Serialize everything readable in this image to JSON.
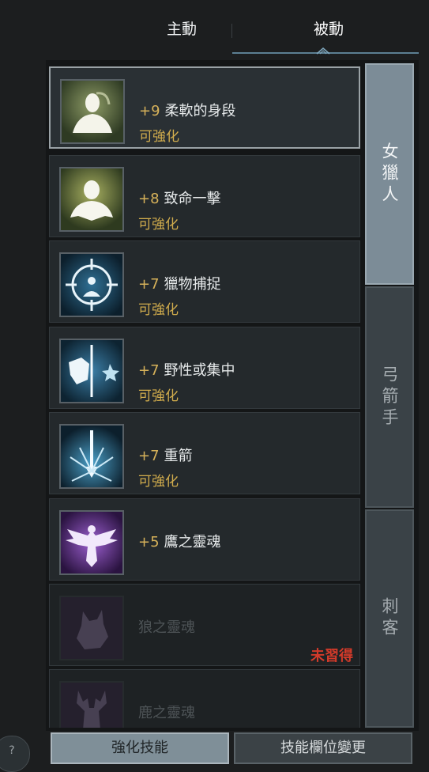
{
  "tabs": {
    "active_label": "主動",
    "passive_label": "被動",
    "selected": "passive"
  },
  "skills": [
    {
      "level": "+9",
      "name": "柔軟的身段",
      "status": "可強化",
      "icon": "woman-silhouette-icon",
      "selected": true,
      "locked": false
    },
    {
      "level": "+8",
      "name": "致命一擊",
      "status": "可強化",
      "icon": "bust-silhouette-icon",
      "selected": false,
      "locked": false
    },
    {
      "level": "+7",
      "name": "獵物捕捉",
      "status": "可強化",
      "icon": "crosshair-icon",
      "selected": false,
      "locked": false
    },
    {
      "level": "+7",
      "name": "野性或集中",
      "status": "可強化",
      "icon": "wolf-moon-icon",
      "selected": false,
      "locked": false
    },
    {
      "level": "+7",
      "name": "重箭",
      "status": "可強化",
      "icon": "arrow-burst-icon",
      "selected": false,
      "locked": false
    },
    {
      "level": "+5",
      "name": "鷹之靈魂",
      "status": "",
      "icon": "eagle-icon",
      "selected": false,
      "locked": false
    },
    {
      "level": "",
      "name": "狼之靈魂",
      "status": "",
      "icon": "wolf-icon",
      "selected": false,
      "locked": true,
      "locked_label": "未習得"
    },
    {
      "level": "",
      "name": "鹿之靈魂",
      "status": "",
      "icon": "deer-icon",
      "selected": false,
      "locked": true
    }
  ],
  "class_tabs": [
    {
      "label": "女獵人",
      "active": true
    },
    {
      "label": "弓箭手",
      "active": false
    },
    {
      "label": "刺客",
      "active": false
    }
  ],
  "bottom": {
    "enhance_label": "強化技能",
    "change_label": "技能欄位變更"
  },
  "help": {
    "label": "?"
  },
  "colors": {
    "accent_gold": "#d2ad4d",
    "locked_red": "#d23a2a",
    "tab_active": "#7c8c97"
  }
}
